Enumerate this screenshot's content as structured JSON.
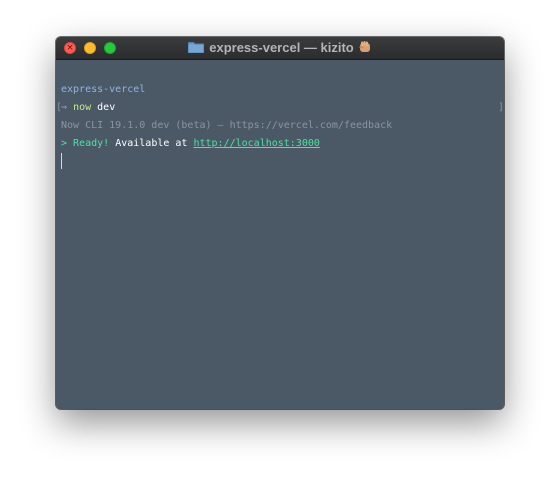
{
  "window": {
    "title": "express-vercel — kizito",
    "title_folder_icon": "folder-icon",
    "title_emoji_icon": "raised-fist-icon",
    "controls": [
      "close",
      "minimize",
      "maximize"
    ],
    "colors": {
      "background": "#4b5967",
      "titlebar": "#333435",
      "close": "#fe5f57",
      "minimize": "#febc2e",
      "maximize": "#28c840"
    }
  },
  "terminal": {
    "prompt_directory": "express-vercel",
    "prompt_arrow": "⇒",
    "command": "now",
    "command_args": "dev",
    "cli_info": "Now CLI 19.1.0 dev (beta) — https://vercel.com/feedback",
    "ready_prefix": "> Ready!",
    "available_text": " Available at ",
    "url": "http://localhost:3000",
    "colors": {
      "directory": "#8fb3e5",
      "arrow": "#c792ea",
      "command": "#c3e88d",
      "muted": "#8a949e",
      "ready": "#4ee0a5"
    }
  }
}
